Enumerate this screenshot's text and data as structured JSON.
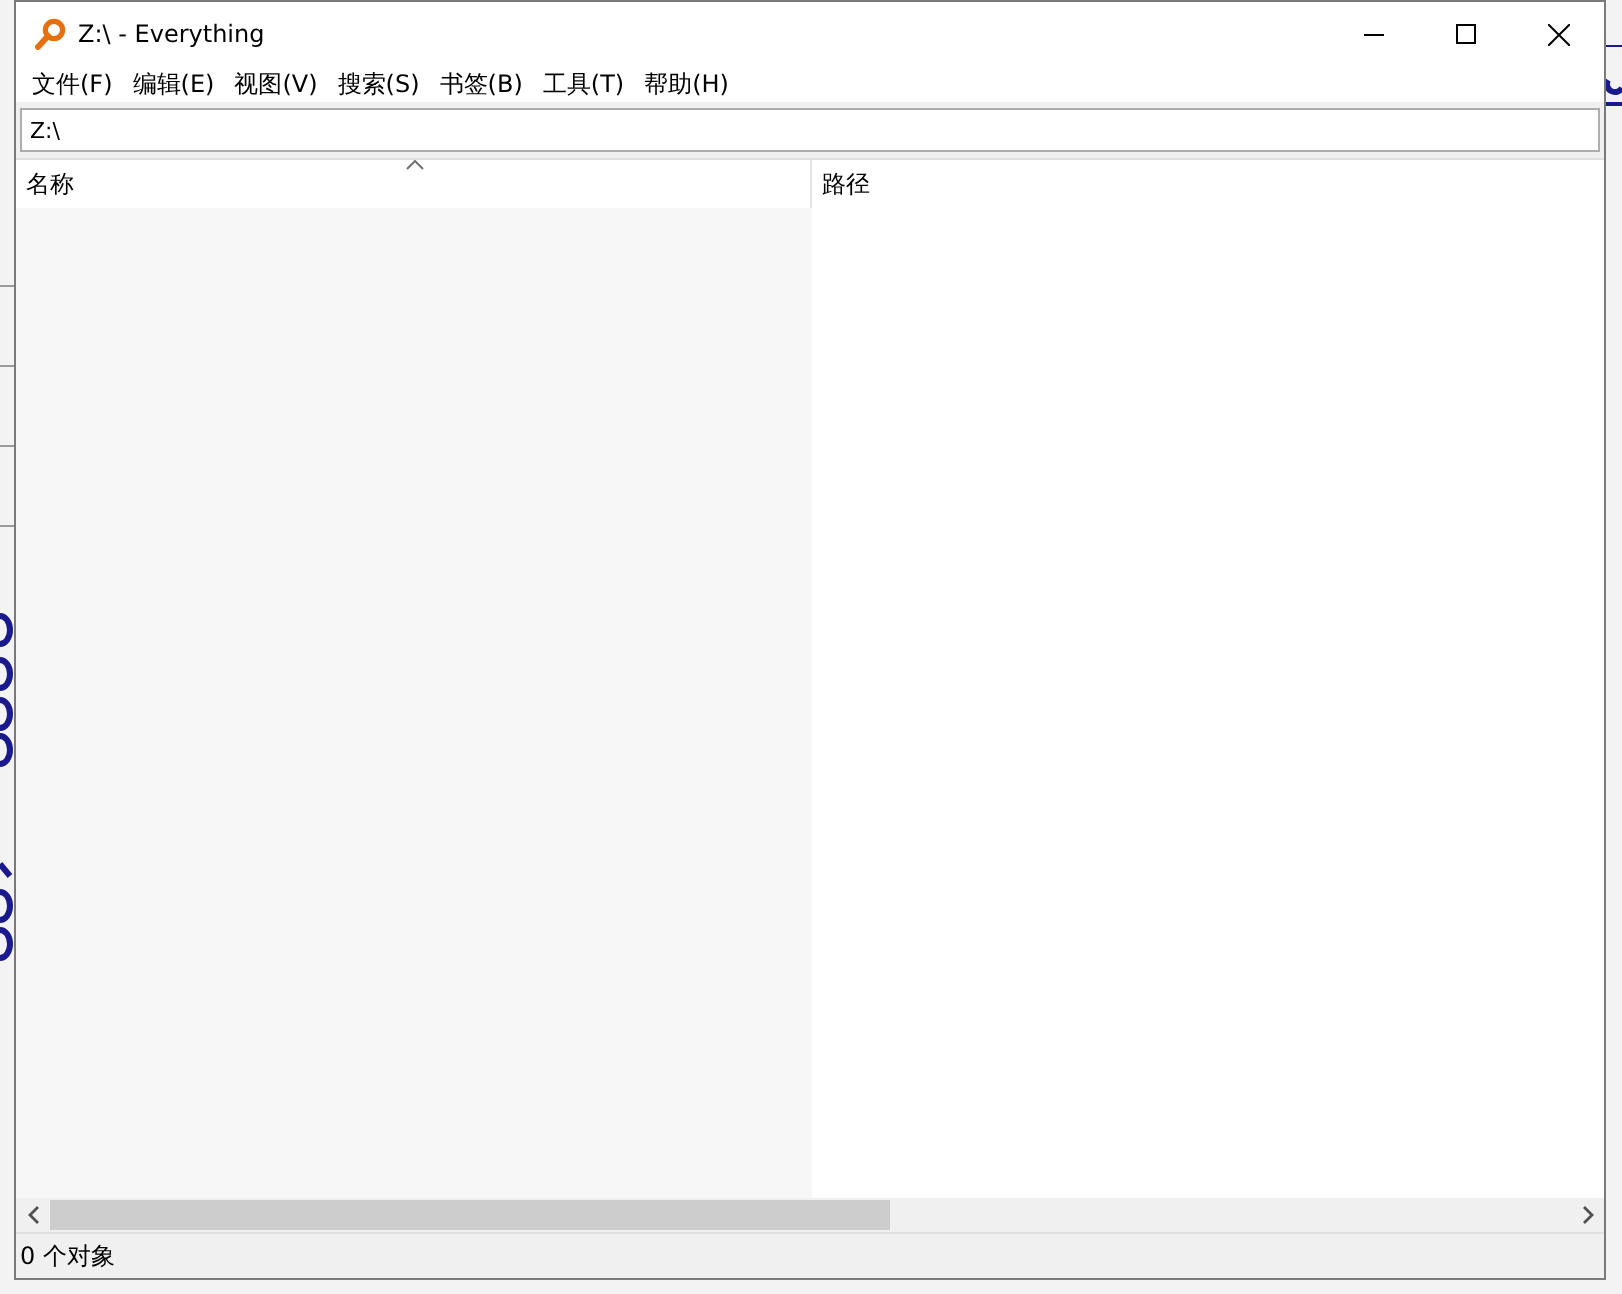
{
  "window": {
    "title": "Z:\\ - Everything"
  },
  "menu": [
    {
      "label": "文件(F)"
    },
    {
      "label": "编辑(E)"
    },
    {
      "label": "视图(V)"
    },
    {
      "label": "搜索(S)"
    },
    {
      "label": "书签(B)"
    },
    {
      "label": "工具(T)"
    },
    {
      "label": "帮助(H)"
    }
  ],
  "search": {
    "value": "Z:\\"
  },
  "columns": [
    {
      "label": "名称",
      "sorted": true
    },
    {
      "label": "路径",
      "sorted": false
    }
  ],
  "status_bar": "0 个对象"
}
